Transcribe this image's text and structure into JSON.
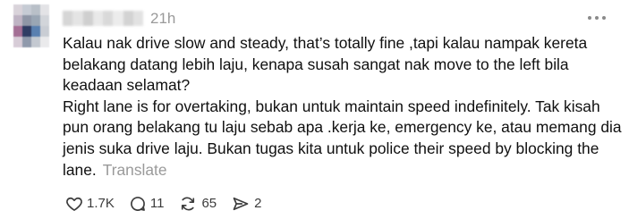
{
  "post": {
    "timestamp": "21h",
    "paragraphs": [
      "Kalau nak drive slow and steady, that’s totally fine ,tapi kalau nampak kereta belakang datang lebih laju, kenapa susah sangat nak move to the left bila keadaan selamat?",
      "Right lane is for overtaking, bukan untuk maintain speed indefinitely. Tak kisah pun orang belakang tu laju sebab apa .kerja ke, emergency ke, atau memang dia jenis suka drive laju. Bukan tugas kita untuk police their speed by blocking the lane."
    ],
    "translate_label": "Translate"
  },
  "actions": {
    "like": {
      "icon": "heart-icon",
      "count": "1.7K"
    },
    "reply": {
      "icon": "comment-icon",
      "count": "11"
    },
    "repost": {
      "icon": "repost-icon",
      "count": "65"
    },
    "share": {
      "icon": "send-icon",
      "count": "2"
    }
  },
  "colors": {
    "text": "#101010",
    "secondary": "#9a9a9a",
    "icon": "#3c3c3c",
    "background": "#ffffff"
  }
}
